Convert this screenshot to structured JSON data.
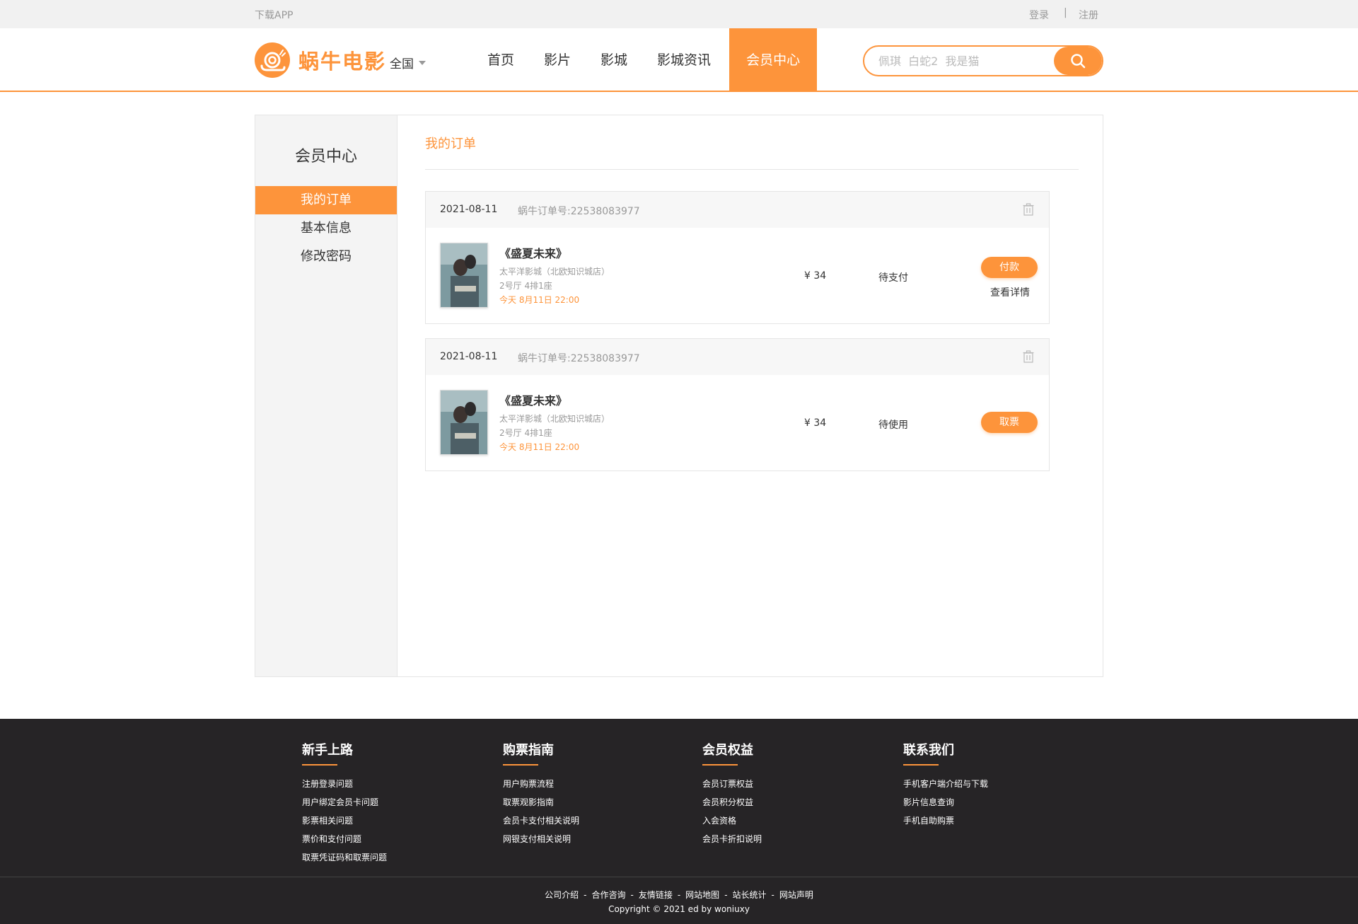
{
  "topbar": {
    "download": "下载APP",
    "login": "登录",
    "separator": "|",
    "register": "注册"
  },
  "header": {
    "logo_text": "蜗牛电影",
    "city": "全国",
    "nav": [
      {
        "label": "首页",
        "active": false
      },
      {
        "label": "影片",
        "active": false
      },
      {
        "label": "影城",
        "active": false
      },
      {
        "label": "影城资讯",
        "active": false
      },
      {
        "label": "会员中心",
        "active": true
      }
    ],
    "search_placeholder": "佩琪  白蛇2  我是猫"
  },
  "sidebar": {
    "title": "会员中心",
    "items": [
      {
        "label": "我的订单",
        "active": true
      },
      {
        "label": "基本信息",
        "active": false
      },
      {
        "label": "修改密码",
        "active": false
      }
    ]
  },
  "content": {
    "title": "我的订单",
    "orders": [
      {
        "date": "2021-08-11",
        "order_no": "蜗牛订单号:22538083977",
        "movie": "《盛夏未来》",
        "cinema": "太平洋影城（北欧知识城店）",
        "seat": "2号厅  4排1座",
        "time": "今天 8月11日 22:00",
        "price": "¥ 34",
        "status": "待支付",
        "action": "付款",
        "detail": "查看详情"
      },
      {
        "date": "2021-08-11",
        "order_no": "蜗牛订单号:22538083977",
        "movie": "《盛夏未来》",
        "cinema": "太平洋影城（北欧知识城店）",
        "seat": "2号厅  4排1座",
        "time": "今天 8月11日 22:00",
        "price": "¥ 34",
        "status": "待使用",
        "action": "取票"
      }
    ]
  },
  "footer": {
    "columns": [
      {
        "title": "新手上路",
        "links": [
          "注册登录问题",
          "用户绑定会员卡问题",
          "影票相关问题",
          "票价和支付问题",
          "取票凭证码和取票问题"
        ]
      },
      {
        "title": "购票指南",
        "links": [
          "用户购票流程",
          "取票观影指南",
          "会员卡支付相关说明",
          "网银支付相关说明"
        ]
      },
      {
        "title": "会员权益",
        "links": [
          "会员订票权益",
          "会员积分权益",
          "入会资格",
          "会员卡折扣说明"
        ]
      },
      {
        "title": "联系我们",
        "links": [
          "手机客户端介绍与下载",
          "影片信息查询",
          "手机自助购票"
        ]
      }
    ],
    "bottom_links": [
      "公司介绍",
      "合作咨询",
      "友情链接",
      "网站地图",
      "站长统计",
      "网站声明"
    ],
    "bottom_sep": "-",
    "copyright": "Copyright © 2021 ed by woniuxy"
  },
  "colors": {
    "accent": "#fd943b",
    "footer_bg": "#262426"
  },
  "icons": [
    "snail-logo-icon",
    "caret-down-icon",
    "search-icon",
    "trash-icon"
  ]
}
